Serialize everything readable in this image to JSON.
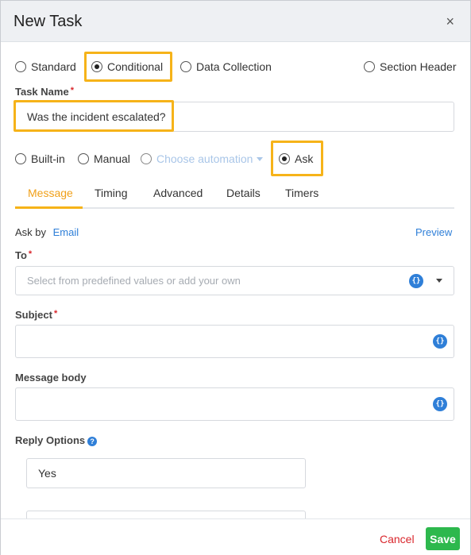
{
  "dialog": {
    "title": "New Task",
    "close_symbol": "×"
  },
  "task_type": {
    "options": [
      {
        "label": "Standard",
        "selected": false
      },
      {
        "label": "Conditional",
        "selected": true
      },
      {
        "label": "Data Collection",
        "selected": false
      },
      {
        "label": "Section Header",
        "selected": false
      }
    ]
  },
  "task_name": {
    "label": "Task Name",
    "required_mark": "*",
    "value": "Was the incident escalated?"
  },
  "mode": {
    "options": [
      {
        "label": "Built-in",
        "selected": false
      },
      {
        "label": "Manual",
        "selected": false
      },
      {
        "label": "Choose automation",
        "selected": false,
        "disabled": true
      },
      {
        "label": "Ask",
        "selected": true
      }
    ]
  },
  "tabs": [
    "Message",
    "Timing",
    "Advanced",
    "Details",
    "Timers"
  ],
  "active_tab": "Message",
  "message": {
    "ask_by_label": "Ask by",
    "ask_by_value": "Email",
    "preview_label": "Preview",
    "to": {
      "label": "To",
      "required_mark": "*",
      "placeholder": "Select from predefined values or add your own"
    },
    "subject": {
      "label": "Subject",
      "required_mark": "*",
      "value": ""
    },
    "body": {
      "label": "Message body",
      "value": ""
    },
    "brace_symbol": "{}",
    "reply_options": {
      "label": "Reply Options",
      "help_symbol": "?",
      "values": [
        "Yes",
        ""
      ]
    }
  },
  "footer": {
    "cancel_label": "Cancel",
    "save_label": "Save"
  },
  "colors": {
    "highlight": "#f6b319",
    "link": "#2f7fd8",
    "save": "#2db84d",
    "cancel": "#d9262c"
  }
}
